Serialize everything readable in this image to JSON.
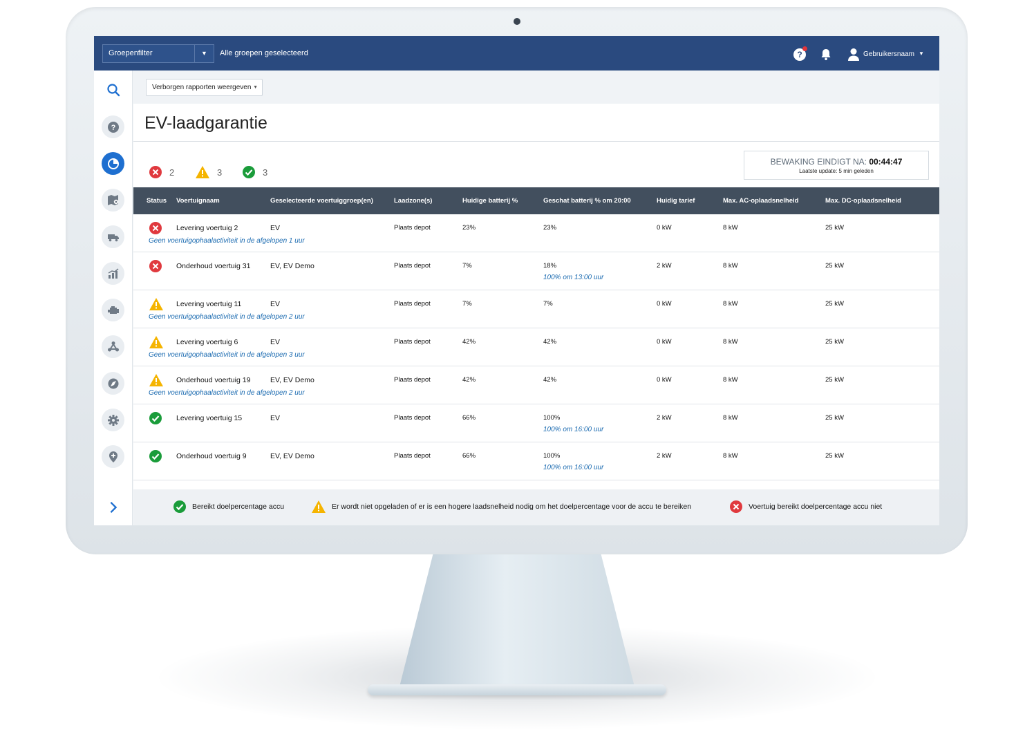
{
  "topbar": {
    "group_filter_label": "Groepenfilter",
    "group_all_text": "Alle groepen geselecteerd",
    "username": "Gebruikersnaam"
  },
  "toolbar": {
    "hidden_reports_label": "Verborgen rapporten weergeven"
  },
  "page": {
    "title": "EV-laadgarantie"
  },
  "summary": {
    "error_count": "2",
    "warning_count": "3",
    "ok_count": "3"
  },
  "countdown": {
    "label": "BEWAKING EINDIGT NA:",
    "time": "00:44:47",
    "last_update": "Laatste update: 5 min geleden"
  },
  "table": {
    "headers": [
      "Status",
      "Voertuignaam",
      "Geselecteerde voertuiggroep(en)",
      "Laadzone(s)",
      "Huidige batterij %",
      "Geschat batterij % om 20:00",
      "Huidig tarief",
      "Max. AC-oplaadsnelheid",
      "Max. DC-oplaadsnelheid"
    ],
    "rows": [
      {
        "status": "error",
        "name": "Levering voertuig 2",
        "groups": "EV",
        "zone": "Plaats depot",
        "current": "23%",
        "estimate": "23%",
        "estimate_note": "",
        "rate": "0 kW",
        "ac": "8 kW",
        "dc": "25 kW",
        "note": "Geen voertuigophaalactiviteit in de afgelopen 1 uur"
      },
      {
        "status": "error",
        "name": "Onderhoud voertuig 31",
        "groups": "EV, EV Demo",
        "zone": "Plaats depot",
        "current": "7%",
        "estimate": "18%",
        "estimate_note": "100% om 13:00 uur",
        "rate": "2 kW",
        "ac": "8 kW",
        "dc": "25 kW",
        "note": ""
      },
      {
        "status": "warning",
        "name": "Levering voertuig 11",
        "groups": "EV",
        "zone": "Plaats depot",
        "current": "7%",
        "estimate": "7%",
        "estimate_note": "",
        "rate": "0 kW",
        "ac": "8 kW",
        "dc": "25 kW",
        "note": "Geen voertuigophaalactiviteit in de afgelopen 2 uur"
      },
      {
        "status": "warning",
        "name": "Levering voertuig 6",
        "groups": "EV",
        "zone": "Plaats depot",
        "current": "42%",
        "estimate": "42%",
        "estimate_note": "",
        "rate": "0 kW",
        "ac": "8 kW",
        "dc": "25 kW",
        "note": "Geen voertuigophaalactiviteit in de afgelopen 3 uur"
      },
      {
        "status": "warning",
        "name": "Onderhoud voertuig 19",
        "groups": "EV, EV Demo",
        "zone": "Plaats depot",
        "current": "42%",
        "estimate": "42%",
        "estimate_note": "",
        "rate": "0 kW",
        "ac": "8 kW",
        "dc": "25 kW",
        "note": "Geen voertuigophaalactiviteit in de afgelopen 2 uur"
      },
      {
        "status": "ok",
        "name": "Levering voertuig 15",
        "groups": "EV",
        "zone": "Plaats depot",
        "current": "66%",
        "estimate": "100%",
        "estimate_note": "100% om 16:00 uur",
        "rate": "2 kW",
        "ac": "8 kW",
        "dc": "25 kW",
        "note": ""
      },
      {
        "status": "ok",
        "name": "Onderhoud voertuig 9",
        "groups": "EV, EV Demo",
        "zone": "Plaats depot",
        "current": "66%",
        "estimate": "100%",
        "estimate_note": "100% om 16:00 uur",
        "rate": "2 kW",
        "ac": "8 kW",
        "dc": "25 kW",
        "note": ""
      }
    ]
  },
  "legend": {
    "ok": "Bereikt doelpercentage accu",
    "warning": "Er wordt niet opgeladen of er is een hogere laadsnelheid nodig om het doelpercentage voor de accu te bereiken",
    "error": "Voertuig bereikt doelpercentage accu niet"
  },
  "colors": {
    "topbar": "#2a4a7f",
    "error": "#e0393e",
    "warning": "#f5b400",
    "ok": "#1a9c3a",
    "table_header": "#424f5e",
    "note": "#1a6ab0"
  }
}
